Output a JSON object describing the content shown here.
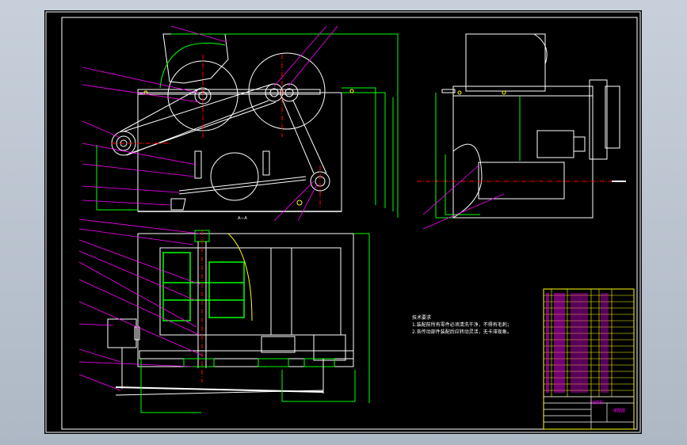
{
  "drawing": {
    "section_label": "A—A",
    "notes_title": "技术要求",
    "notes": [
      "1.装配前所有零件必须清洗干净，不得有毛刺；",
      "2.各传动部件装配后应转动灵活，无卡滞现象。"
    ],
    "title_block": {
      "title": "切菜机",
      "drawing_no": "装配图"
    }
  },
  "colors": {
    "frame": "#ffffff",
    "outline": "#ffffff",
    "dimension": "#00ff00",
    "leader": "#ff00ff",
    "centerline": "#ff0000",
    "hidden": "#ffff00",
    "part": "#00ff00",
    "bom_text": "#ff00ff"
  }
}
